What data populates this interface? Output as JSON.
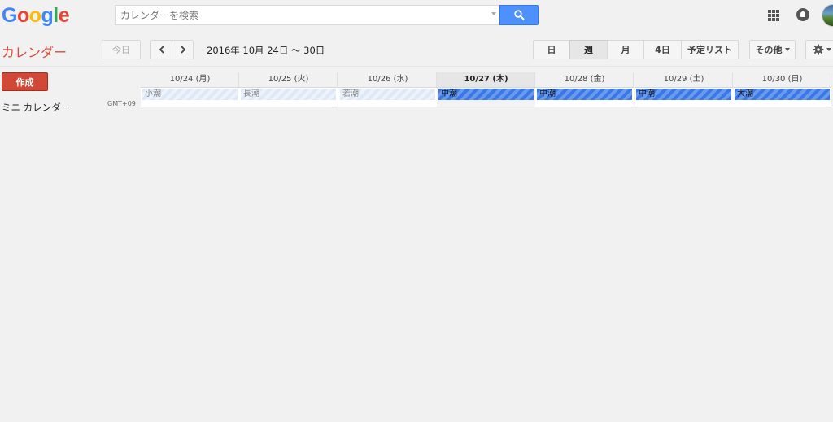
{
  "logo": [
    "G",
    "o",
    "o",
    "g",
    "l",
    "e"
  ],
  "logo_colors": [
    "#4285f4",
    "#ea4335",
    "#fbbc05",
    "#4285f4",
    "#34a853",
    "#ea4335"
  ],
  "search": {
    "placeholder": "カレンダーを検索"
  },
  "app_title": "カレンダー",
  "toolbar": {
    "today_label": "今日",
    "date_range": "2016年 10月 24日 〜 30日",
    "views": [
      "日",
      "週",
      "月",
      "4日",
      "予定リスト"
    ],
    "selected_view": "週",
    "more_label": "その他"
  },
  "sidebar": {
    "create_label": "作成",
    "mini_calendar_label": "ミニ カレンダー"
  },
  "timezone": "GMT+09",
  "days": [
    {
      "label": "10/24 (月)",
      "event": "小潮",
      "style": "light",
      "today": false
    },
    {
      "label": "10/25 (火)",
      "event": "長潮",
      "style": "light",
      "today": false
    },
    {
      "label": "10/26 (水)",
      "event": "若潮",
      "style": "light",
      "today": false
    },
    {
      "label": "10/27 (木)",
      "event": "中潮",
      "style": "dark",
      "today": true
    },
    {
      "label": "10/28 (金)",
      "event": "中潮",
      "style": "dark",
      "today": false
    },
    {
      "label": "10/29 (土)",
      "event": "中潮",
      "style": "dark",
      "today": false
    },
    {
      "label": "10/30 (日)",
      "event": "大潮",
      "style": "dark",
      "today": false
    }
  ]
}
